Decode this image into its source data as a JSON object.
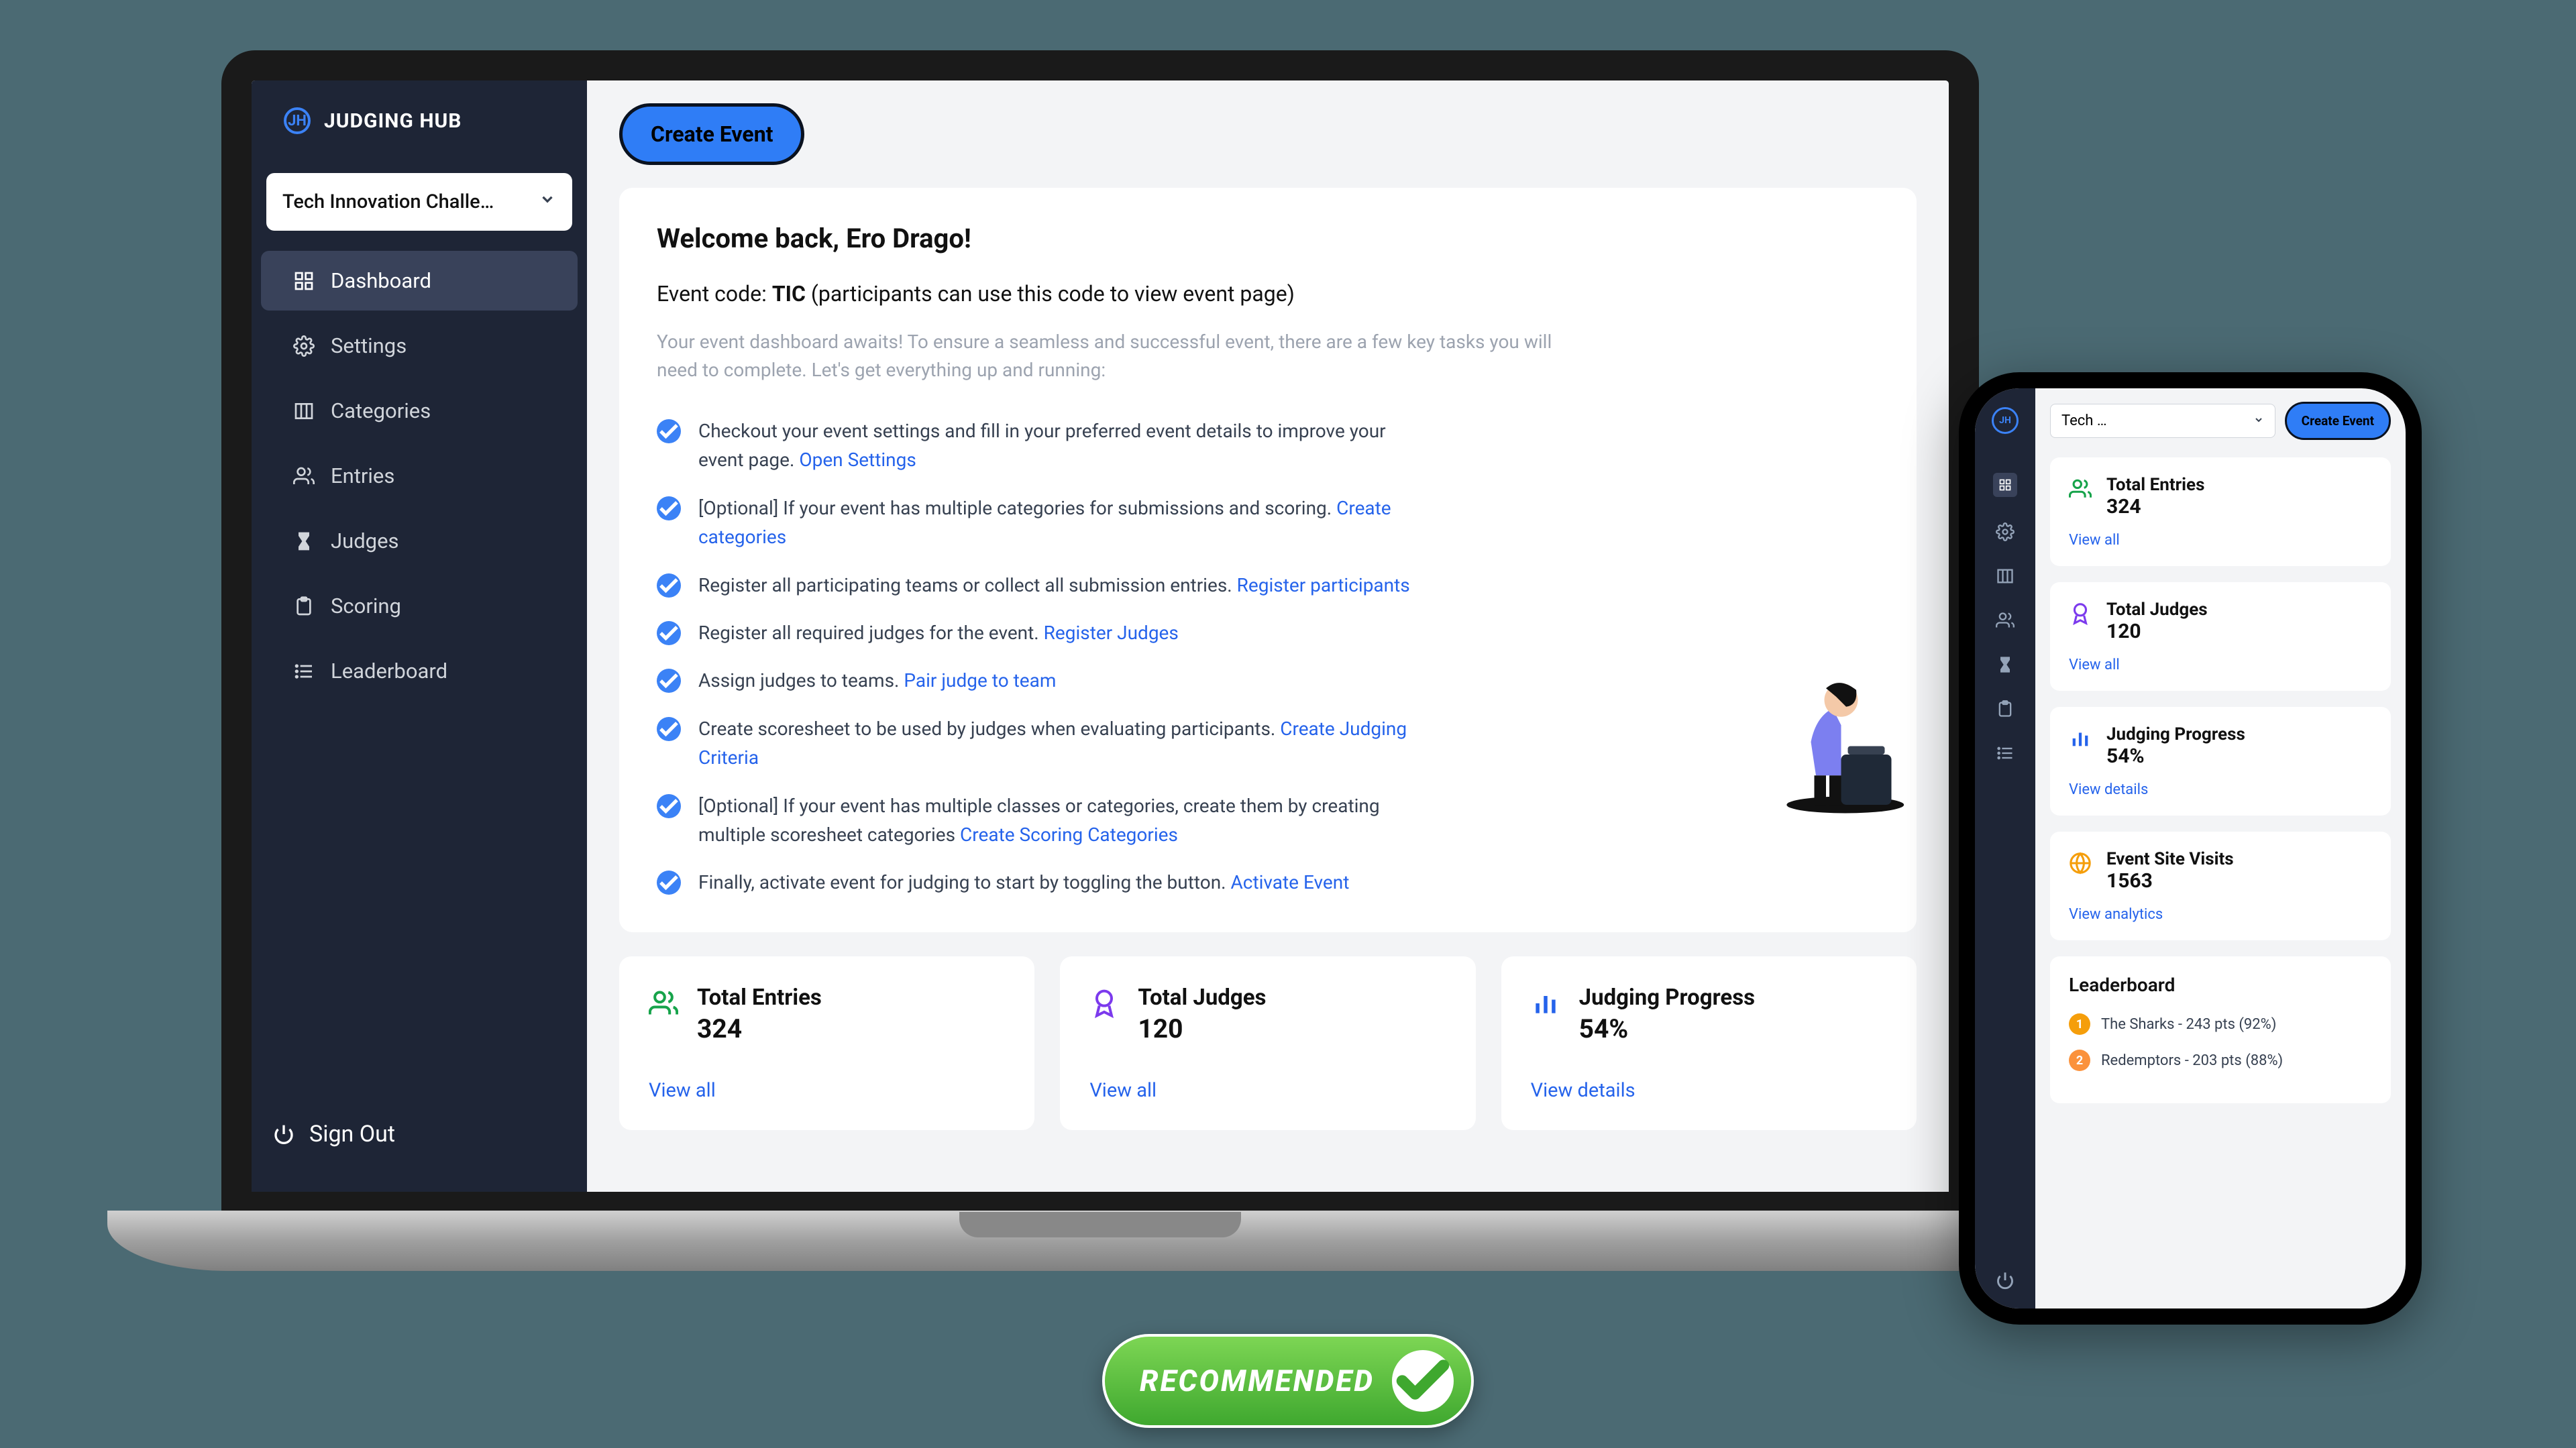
{
  "brand": "JUDGING HUB",
  "event_selected": "Tech Innovation Challe…",
  "sidebar": {
    "items": [
      {
        "label": "Dashboard"
      },
      {
        "label": "Settings"
      },
      {
        "label": "Categories"
      },
      {
        "label": "Entries"
      },
      {
        "label": "Judges"
      },
      {
        "label": "Scoring"
      },
      {
        "label": "Leaderboard"
      }
    ],
    "signout": "Sign Out"
  },
  "create_button": "Create Event",
  "welcome": "Welcome back, Ero Drago!",
  "event_code_prefix": "Event code: ",
  "event_code": "TIC",
  "event_code_suffix": " (participants can use this code to view event page)",
  "intro": "Your event dashboard awaits! To ensure a seamless and successful event, there are a few key tasks you will need to complete. Let's get everything up and running:",
  "checklist": [
    {
      "text_a": "Checkout your event settings and fill in your preferred event details to improve your event page.  ",
      "link": "Open Settings"
    },
    {
      "text_a": "[Optional] If your event has multiple categories for submissions and scoring.  ",
      "link": "Create categories"
    },
    {
      "text_a": "Register all participating teams or collect all submission entries.  ",
      "link": "Register participants"
    },
    {
      "text_a": "Register all required judges for the event. ",
      "link": "Register Judges"
    },
    {
      "text_a": "Assign judges to teams. ",
      "link": "Pair judge to team"
    },
    {
      "text_a": "Create scoresheet to be used by judges when evaluating participants. ",
      "link": "Create Judging Criteria"
    },
    {
      "text_a": "[Optional] If your event has multiple classes or categories, create them by creating multiple scoresheet categories ",
      "link": "Create Scoring Categories"
    },
    {
      "text_a": "Finally, activate event for judging to start by toggling the button. ",
      "link": "Activate Event"
    }
  ],
  "stats": [
    {
      "title": "Total Entries",
      "value": "324",
      "link": "View all",
      "color": "#16a34a"
    },
    {
      "title": "Total Judges",
      "value": "120",
      "link": "View all",
      "color": "#7c3aed"
    },
    {
      "title": "Judging Progress",
      "value": "54%",
      "link": "View details",
      "color": "#2563eb"
    }
  ],
  "mobile": {
    "event_selected": "Tech …",
    "create": "Create Event",
    "stats": [
      {
        "title": "Total Entries",
        "value": "324",
        "link": "View all",
        "color": "#16a34a"
      },
      {
        "title": "Total Judges",
        "value": "120",
        "link": "View all",
        "color": "#7c3aed"
      },
      {
        "title": "Judging Progress",
        "value": "54%",
        "link": "View details",
        "color": "#2563eb"
      },
      {
        "title": "Event Site Visits",
        "value": "1563",
        "link": "View analytics",
        "color": "#f59e0b"
      }
    ],
    "leaderboard_title": "Leaderboard",
    "leaderboard": [
      {
        "rank": "1",
        "text": "The Sharks - 243 pts (92%)"
      },
      {
        "rank": "2",
        "text": "Redemptors - 203 pts (88%)"
      }
    ]
  },
  "badge": "RECOMMENDED"
}
